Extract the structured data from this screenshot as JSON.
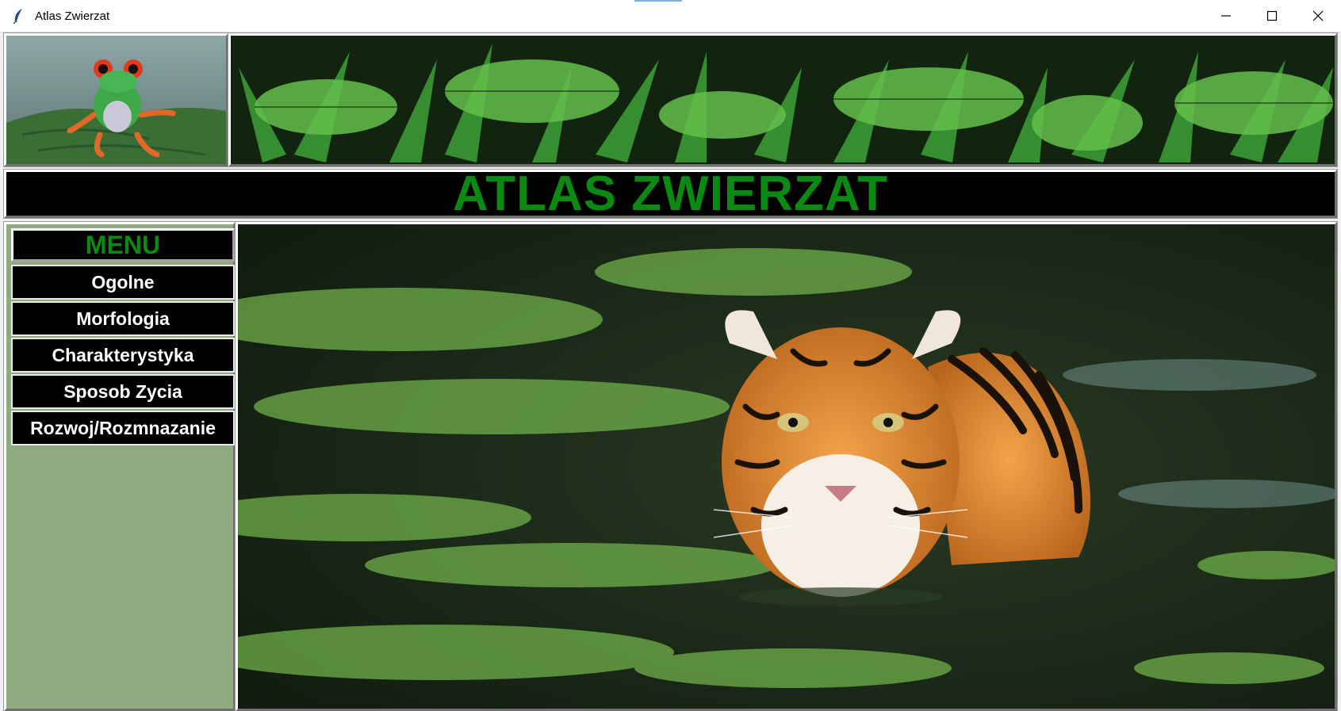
{
  "window": {
    "title": "Atlas Zwierzat",
    "controls": [
      "minimize",
      "maximize",
      "close"
    ]
  },
  "header": {
    "frog_image": "red-eyed-tree-frog-icon",
    "jungle_image": "jungle-palms-icon"
  },
  "banner": {
    "title": "ATLAS ZWIERZAT",
    "color": "#0a8a12"
  },
  "menu": {
    "title": "MENU",
    "items": [
      {
        "label": "Ogolne"
      },
      {
        "label": "Morfologia"
      },
      {
        "label": "Charakterystyka"
      },
      {
        "label": "Sposob Zycia"
      },
      {
        "label": "Rozwoj/Rozmnazanie"
      }
    ],
    "panel_color": "#8fab80"
  },
  "main": {
    "image": "tiger-swimming-icon"
  }
}
